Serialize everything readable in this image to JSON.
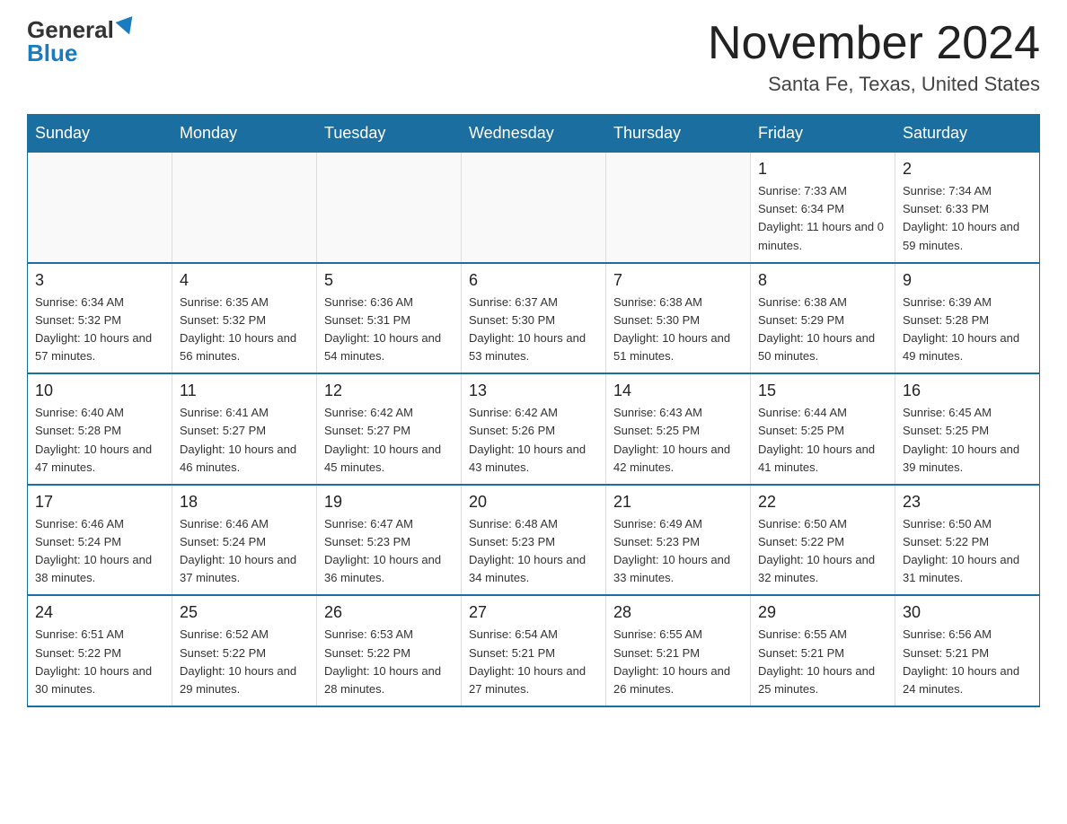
{
  "logo": {
    "general": "General",
    "blue": "Blue"
  },
  "header": {
    "title": "November 2024",
    "location": "Santa Fe, Texas, United States"
  },
  "weekdays": [
    "Sunday",
    "Monday",
    "Tuesday",
    "Wednesday",
    "Thursday",
    "Friday",
    "Saturday"
  ],
  "weeks": [
    [
      {
        "day": "",
        "info": ""
      },
      {
        "day": "",
        "info": ""
      },
      {
        "day": "",
        "info": ""
      },
      {
        "day": "",
        "info": ""
      },
      {
        "day": "",
        "info": ""
      },
      {
        "day": "1",
        "info": "Sunrise: 7:33 AM\nSunset: 6:34 PM\nDaylight: 11 hours and 0 minutes."
      },
      {
        "day": "2",
        "info": "Sunrise: 7:34 AM\nSunset: 6:33 PM\nDaylight: 10 hours and 59 minutes."
      }
    ],
    [
      {
        "day": "3",
        "info": "Sunrise: 6:34 AM\nSunset: 5:32 PM\nDaylight: 10 hours and 57 minutes."
      },
      {
        "day": "4",
        "info": "Sunrise: 6:35 AM\nSunset: 5:32 PM\nDaylight: 10 hours and 56 minutes."
      },
      {
        "day": "5",
        "info": "Sunrise: 6:36 AM\nSunset: 5:31 PM\nDaylight: 10 hours and 54 minutes."
      },
      {
        "day": "6",
        "info": "Sunrise: 6:37 AM\nSunset: 5:30 PM\nDaylight: 10 hours and 53 minutes."
      },
      {
        "day": "7",
        "info": "Sunrise: 6:38 AM\nSunset: 5:30 PM\nDaylight: 10 hours and 51 minutes."
      },
      {
        "day": "8",
        "info": "Sunrise: 6:38 AM\nSunset: 5:29 PM\nDaylight: 10 hours and 50 minutes."
      },
      {
        "day": "9",
        "info": "Sunrise: 6:39 AM\nSunset: 5:28 PM\nDaylight: 10 hours and 49 minutes."
      }
    ],
    [
      {
        "day": "10",
        "info": "Sunrise: 6:40 AM\nSunset: 5:28 PM\nDaylight: 10 hours and 47 minutes."
      },
      {
        "day": "11",
        "info": "Sunrise: 6:41 AM\nSunset: 5:27 PM\nDaylight: 10 hours and 46 minutes."
      },
      {
        "day": "12",
        "info": "Sunrise: 6:42 AM\nSunset: 5:27 PM\nDaylight: 10 hours and 45 minutes."
      },
      {
        "day": "13",
        "info": "Sunrise: 6:42 AM\nSunset: 5:26 PM\nDaylight: 10 hours and 43 minutes."
      },
      {
        "day": "14",
        "info": "Sunrise: 6:43 AM\nSunset: 5:25 PM\nDaylight: 10 hours and 42 minutes."
      },
      {
        "day": "15",
        "info": "Sunrise: 6:44 AM\nSunset: 5:25 PM\nDaylight: 10 hours and 41 minutes."
      },
      {
        "day": "16",
        "info": "Sunrise: 6:45 AM\nSunset: 5:25 PM\nDaylight: 10 hours and 39 minutes."
      }
    ],
    [
      {
        "day": "17",
        "info": "Sunrise: 6:46 AM\nSunset: 5:24 PM\nDaylight: 10 hours and 38 minutes."
      },
      {
        "day": "18",
        "info": "Sunrise: 6:46 AM\nSunset: 5:24 PM\nDaylight: 10 hours and 37 minutes."
      },
      {
        "day": "19",
        "info": "Sunrise: 6:47 AM\nSunset: 5:23 PM\nDaylight: 10 hours and 36 minutes."
      },
      {
        "day": "20",
        "info": "Sunrise: 6:48 AM\nSunset: 5:23 PM\nDaylight: 10 hours and 34 minutes."
      },
      {
        "day": "21",
        "info": "Sunrise: 6:49 AM\nSunset: 5:23 PM\nDaylight: 10 hours and 33 minutes."
      },
      {
        "day": "22",
        "info": "Sunrise: 6:50 AM\nSunset: 5:22 PM\nDaylight: 10 hours and 32 minutes."
      },
      {
        "day": "23",
        "info": "Sunrise: 6:50 AM\nSunset: 5:22 PM\nDaylight: 10 hours and 31 minutes."
      }
    ],
    [
      {
        "day": "24",
        "info": "Sunrise: 6:51 AM\nSunset: 5:22 PM\nDaylight: 10 hours and 30 minutes."
      },
      {
        "day": "25",
        "info": "Sunrise: 6:52 AM\nSunset: 5:22 PM\nDaylight: 10 hours and 29 minutes."
      },
      {
        "day": "26",
        "info": "Sunrise: 6:53 AM\nSunset: 5:22 PM\nDaylight: 10 hours and 28 minutes."
      },
      {
        "day": "27",
        "info": "Sunrise: 6:54 AM\nSunset: 5:21 PM\nDaylight: 10 hours and 27 minutes."
      },
      {
        "day": "28",
        "info": "Sunrise: 6:55 AM\nSunset: 5:21 PM\nDaylight: 10 hours and 26 minutes."
      },
      {
        "day": "29",
        "info": "Sunrise: 6:55 AM\nSunset: 5:21 PM\nDaylight: 10 hours and 25 minutes."
      },
      {
        "day": "30",
        "info": "Sunrise: 6:56 AM\nSunset: 5:21 PM\nDaylight: 10 hours and 24 minutes."
      }
    ]
  ]
}
